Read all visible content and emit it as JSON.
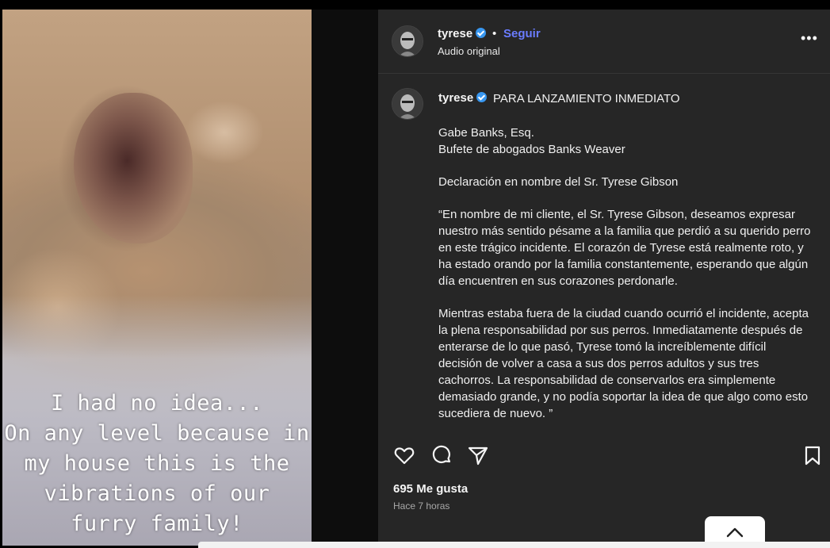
{
  "media": {
    "caption_lines": [
      "I had no idea...",
      "On any level because in",
      "my house this is the",
      "vibrations of our",
      "furry family!"
    ]
  },
  "header": {
    "username": "tyrese",
    "separator": "•",
    "follow_label": "Seguir",
    "subtitle": "Audio original",
    "more_icon": "more-horizontal-icon"
  },
  "post": {
    "username": "tyrese",
    "headline": "PARA LANZAMIENTO INMEDIATO",
    "paragraphs": [
      "Gabe Banks, Esq.\nBufete de abogados Banks Weaver",
      "Declaración en nombre del Sr. Tyrese Gibson",
      "“En nombre de mi cliente, el Sr. Tyrese Gibson, deseamos expresar nuestro más sentido pésame a la familia que perdió a su querido perro en este trágico incidente. El corazón de Tyrese está realmente roto, y ha estado orando por la familia constantemente, esperando que algún día encuentren en sus corazones perdonarle.",
      "Mientras estaba fuera de la ciudad cuando ocurrió el incidente, acepta la plena responsabilidad por sus perros. Inmediatamente después de enterarse de lo que pasó, Tyrese tomó la increíblemente difícil decisión de volver a casa a sus dos perros adultos y sus tres cachorros. La responsabilidad de conservarlos era simplemente demasiado grande, y no podía soportar la idea de que algo como esto sucediera de nuevo. ”"
    ]
  },
  "actions": {
    "icons": [
      "heart-icon",
      "comment-icon",
      "share-icon",
      "bookmark-icon"
    ]
  },
  "stats": {
    "likes": "695 Me gusta",
    "time": "Hace 7 horas"
  },
  "colors": {
    "panel_bg": "#262626",
    "follow": "#6a7cff",
    "verified": "#3897f0"
  }
}
